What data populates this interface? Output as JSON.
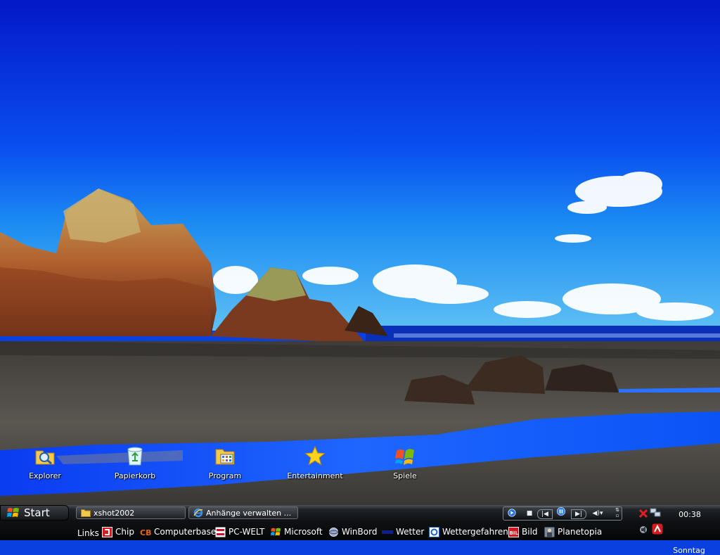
{
  "desktop": {
    "icons": [
      {
        "label": "Explorer",
        "icon": "search-folder-icon"
      },
      {
        "label": "Papierkorb",
        "icon": "recycle-bin-icon"
      },
      {
        "label": "Program",
        "icon": "programs-folder-icon"
      },
      {
        "label": "Entertainment",
        "icon": "star-icon"
      },
      {
        "label": "Spiele",
        "icon": "games-icon"
      }
    ]
  },
  "taskbar": {
    "start_label": "Start",
    "tasks": [
      {
        "label": "xshot2002",
        "icon": "folder-icon"
      },
      {
        "label": "Anhänge verwalten ...",
        "icon": "internet-explorer-icon"
      }
    ],
    "links_label": "Links",
    "links": [
      {
        "label": "Chip",
        "icon": "chip-icon",
        "color": "#d71920"
      },
      {
        "label": "Computerbase",
        "icon": "computerbase-icon",
        "color": "#e8661c"
      },
      {
        "label": "PC-WELT",
        "icon": "pcwelt-icon",
        "color": "#c8102e"
      },
      {
        "label": "Microsoft",
        "icon": "windows-flag-icon",
        "color": "#f25022"
      },
      {
        "label": "WinBord",
        "icon": "winbord-icon",
        "color": "#9aa9c8"
      },
      {
        "label": "Wetter",
        "icon": "wetter-icon",
        "color": "#0b1f8f"
      },
      {
        "label": "Wettergefahren",
        "icon": "wettergefahren-icon",
        "color": "#1d5fbf"
      },
      {
        "label": "Bild",
        "icon": "bild-icon",
        "color": "#d8141f"
      },
      {
        "label": "Planetopia",
        "icon": "planetopia-icon",
        "color": "#7a8a9a"
      }
    ],
    "clock": "00:38",
    "day": "Sonntag"
  },
  "colors": {
    "sky": "#0a3fe0",
    "taskbar": "#0e1012",
    "text": "#ffffff"
  }
}
